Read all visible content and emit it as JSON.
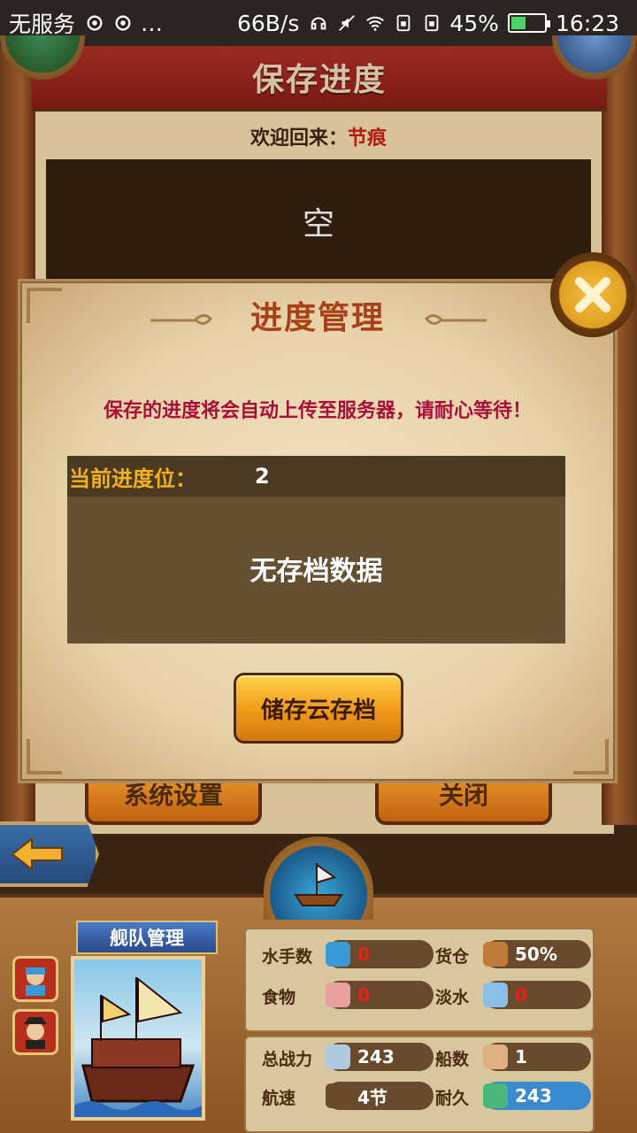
{
  "status_bar": {
    "carrier": "无服务",
    "extra_icons": "…",
    "net_speed": "66B/s",
    "battery": "45%",
    "battery_level": 0.45,
    "time": "16:23"
  },
  "back_screen": {
    "title": "保存进度",
    "welcome_label": "欢迎回来：",
    "user_name": "节痕",
    "slot_text": "空",
    "button_left": "系统设置",
    "button_right": "关闭"
  },
  "dialog": {
    "title": "进度管理",
    "notice": "保存的进度将会自动上传至服务器，请耐心等待！",
    "slot_label": "当前进度位：",
    "slot_value": "2",
    "empty_text": "无存档数据",
    "save_button": "储存云存档"
  },
  "fleet": {
    "tab_label": "舰队管理",
    "stats": [
      {
        "label": "水手数",
        "value": "0",
        "icon": "sailor-icon"
      },
      {
        "label": "货仓",
        "value": "50%",
        "icon": "cargo-icon"
      },
      {
        "label": "食物",
        "value": "0",
        "icon": "meat-icon"
      },
      {
        "label": "淡水",
        "value": "0",
        "icon": "water-icon"
      },
      {
        "label": "总战力",
        "value": "243",
        "icon": "swords-icon"
      },
      {
        "label": "船数",
        "value": "1",
        "icon": "ship-icon"
      },
      {
        "label": "航速",
        "value": "4节",
        "icon": "sail-icon"
      },
      {
        "label": "耐久",
        "value": "243",
        "icon": "durability-icon"
      }
    ]
  },
  "colors": {
    "accent": "#f09a18",
    "title_red": "#a8401a",
    "notice_red": "#a8103a",
    "slot_label": "#f0b020"
  }
}
